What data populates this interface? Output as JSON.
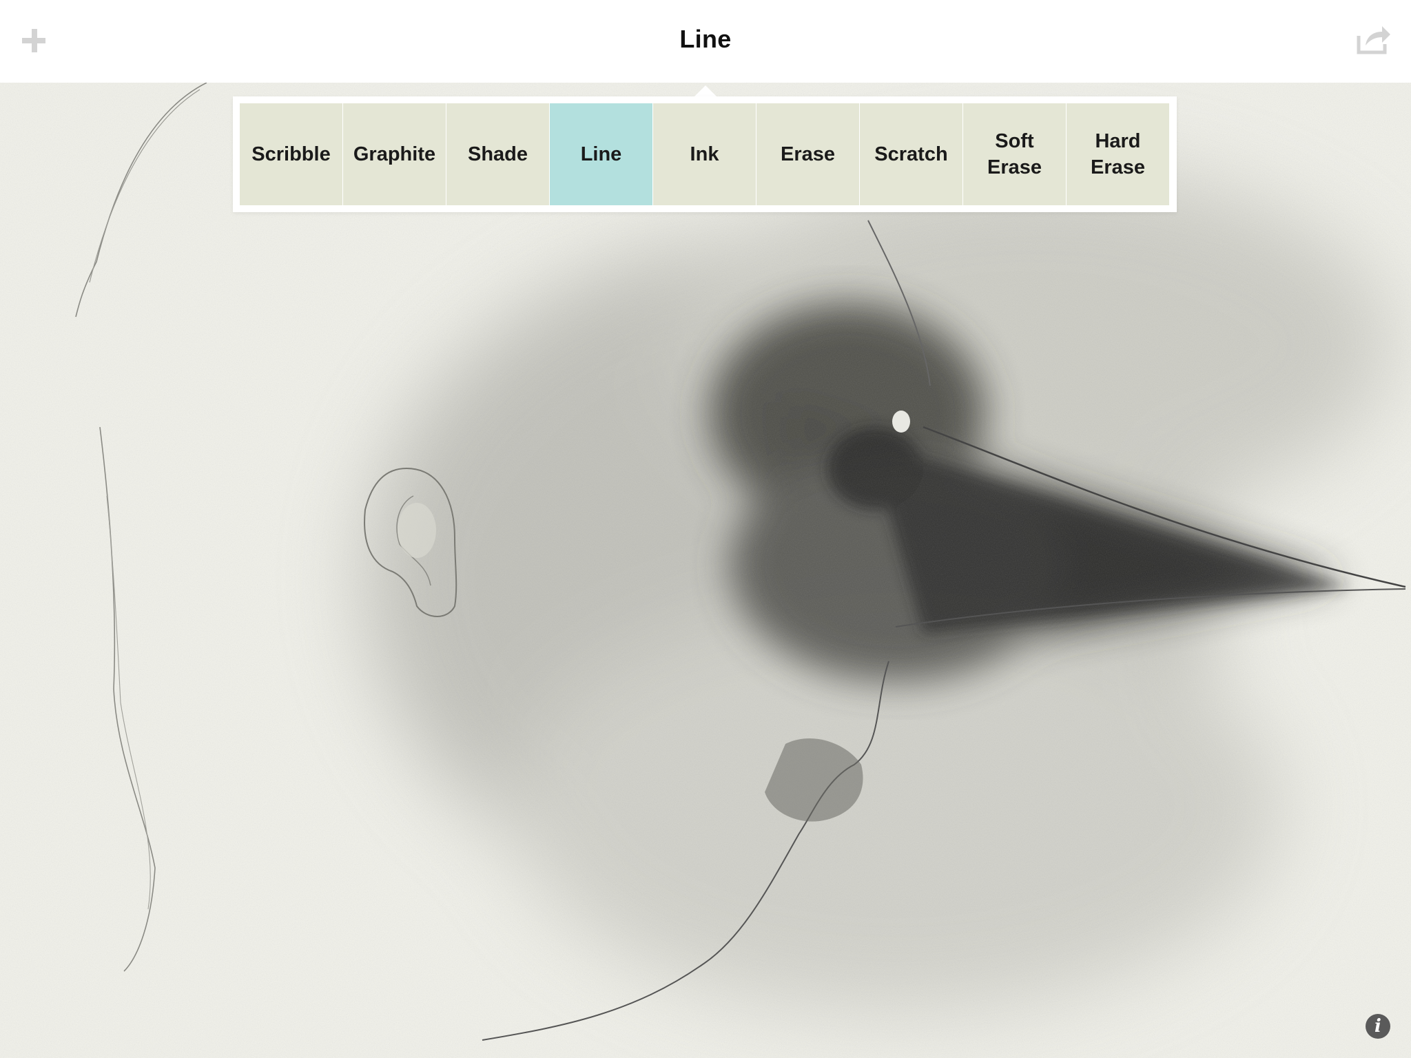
{
  "nav": {
    "title": "Line",
    "add_icon": "plus-icon",
    "share_icon": "share-icon"
  },
  "tools": [
    {
      "label": "Scribble",
      "active": false
    },
    {
      "label": "Graphite",
      "active": false
    },
    {
      "label": "Shade",
      "active": false
    },
    {
      "label": "Line",
      "active": true
    },
    {
      "label": "Ink",
      "active": false
    },
    {
      "label": "Erase",
      "active": false
    },
    {
      "label": "Scratch",
      "active": false
    },
    {
      "label": "Soft\nErase",
      "active": false
    },
    {
      "label": "Hard\nErase",
      "active": false
    }
  ],
  "info": {
    "glyph": "i",
    "icon": "info-icon"
  },
  "colors": {
    "canvas": "#f1f1ea",
    "tool_bg": "#e4e6d5",
    "tool_active": "#b3e0de",
    "icon_gray": "#d3d3d3"
  }
}
